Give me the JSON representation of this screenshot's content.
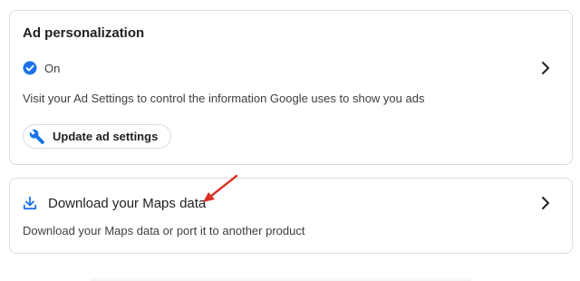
{
  "ad_personalization": {
    "title": "Ad personalization",
    "status_label": "On",
    "description": "Visit your Ad Settings to control the information Google uses to show you ads",
    "update_button_label": "Update ad settings",
    "icons": {
      "status": "check-circle-icon",
      "button": "wrench-icon",
      "nav": "chevron-right-icon"
    }
  },
  "maps_data": {
    "title": "Download your Maps data",
    "description": "Download your Maps data or port it to another product",
    "icons": {
      "title": "download-icon",
      "nav": "chevron-right-icon"
    }
  },
  "colors": {
    "accent_blue": "#1a73e8",
    "annotation_red": "#d93025",
    "border": "#dadce0"
  }
}
